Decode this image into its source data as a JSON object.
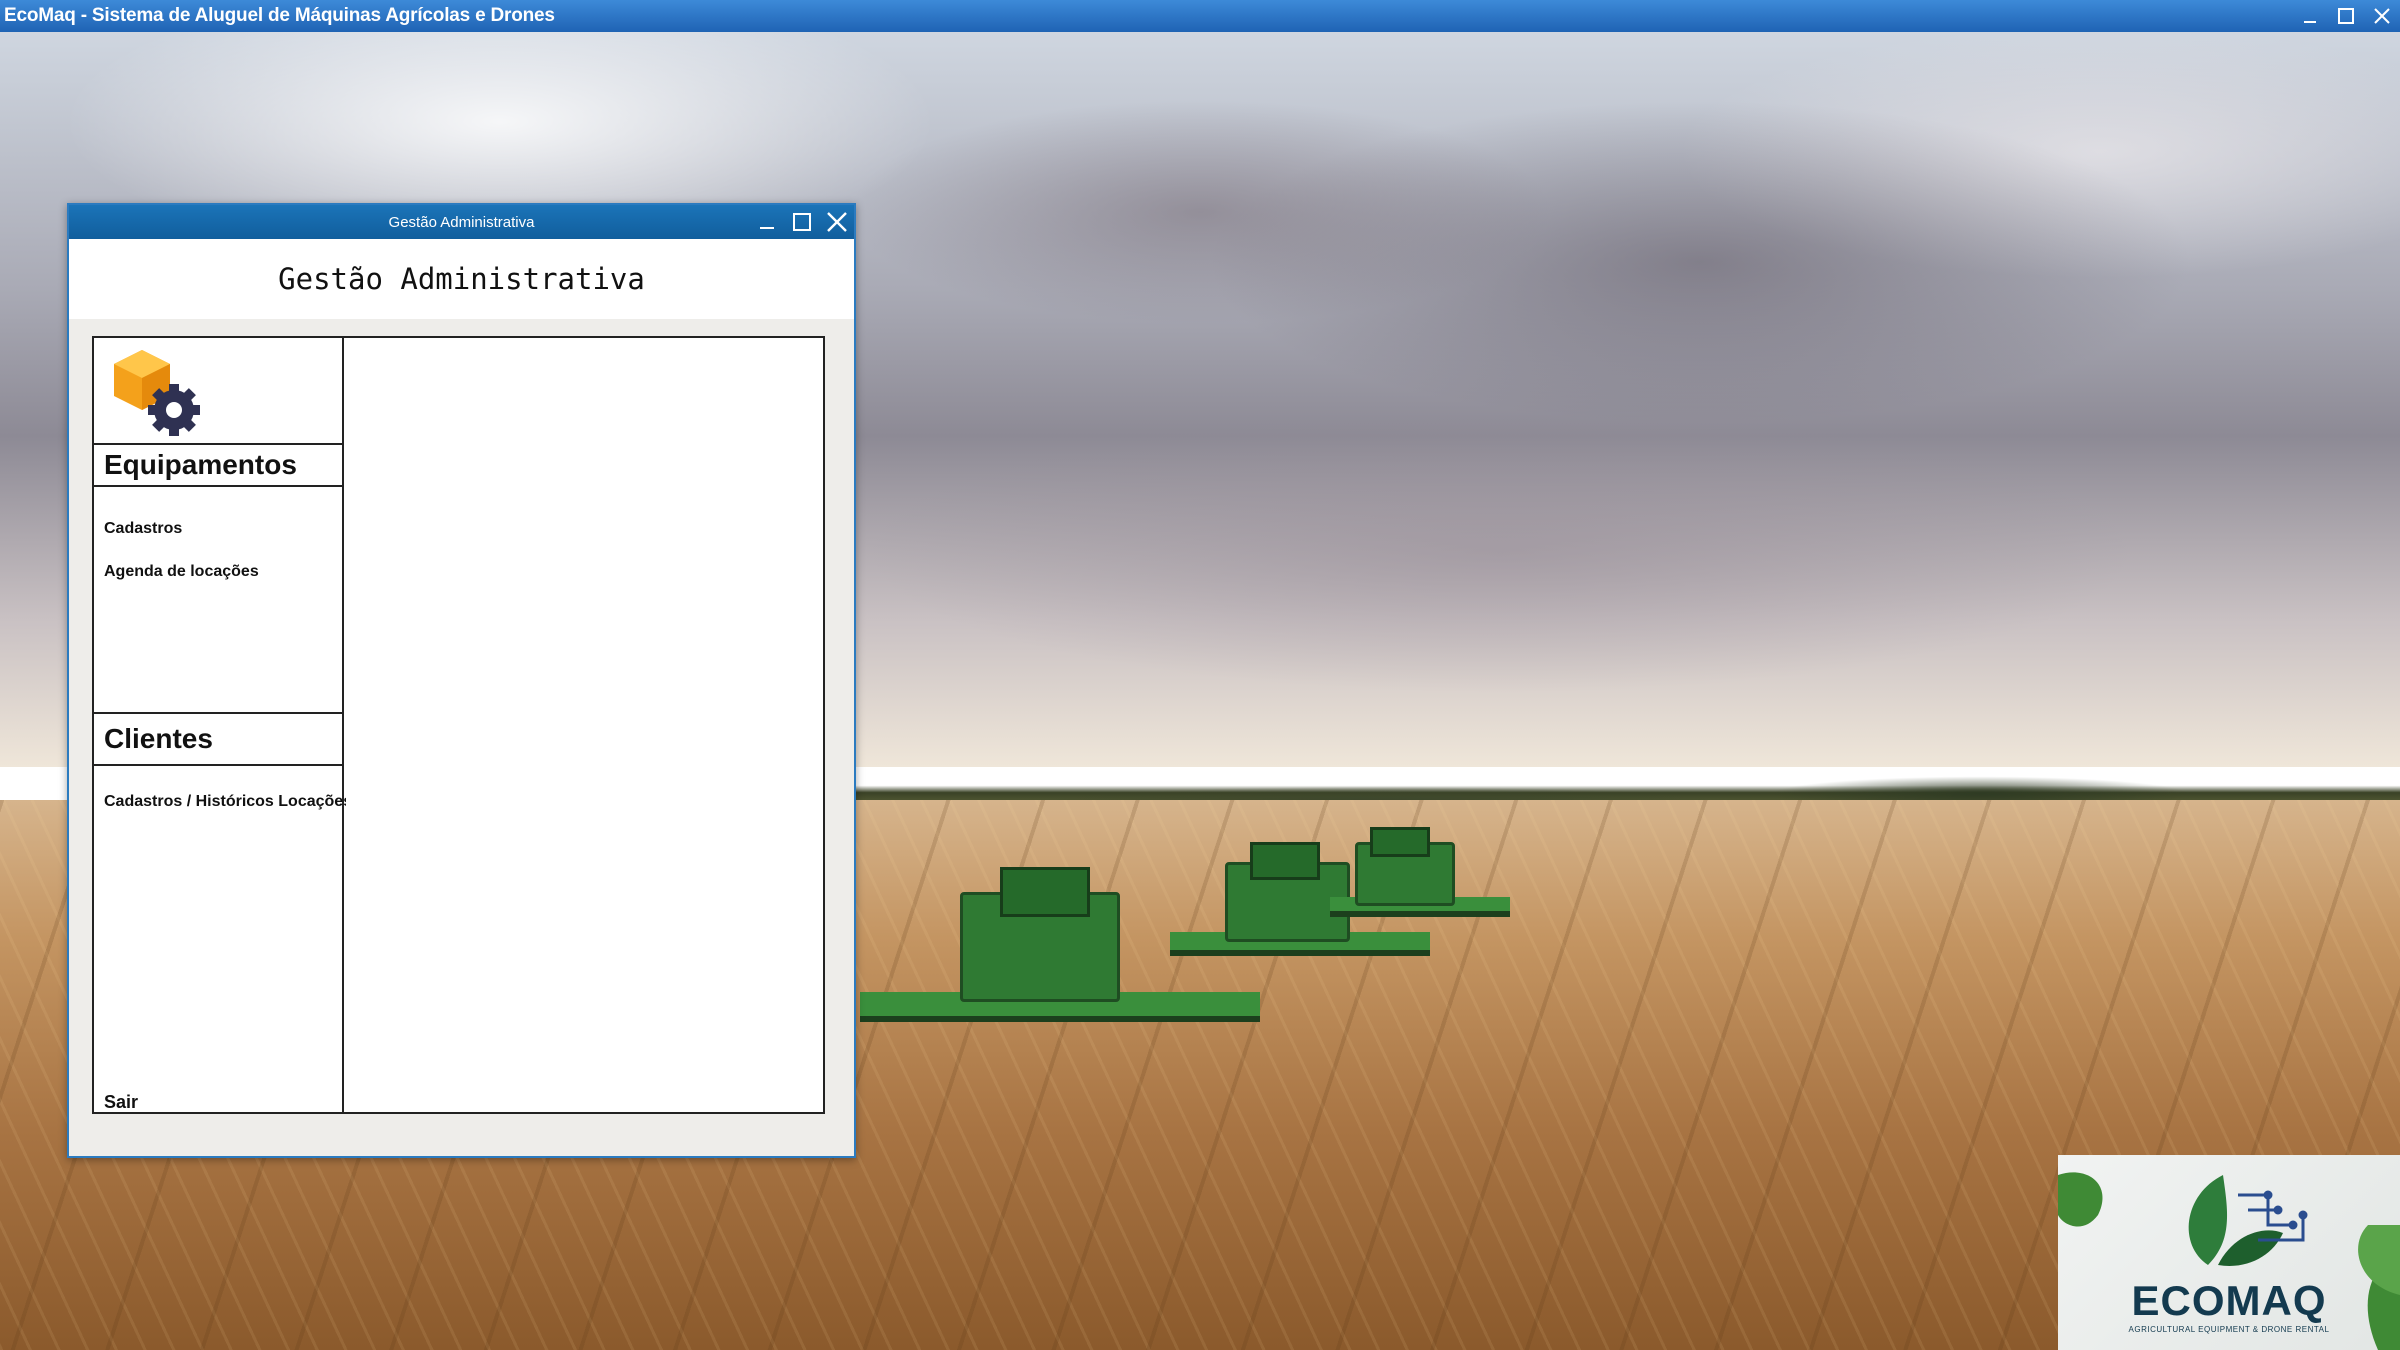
{
  "app": {
    "title": "EcoMaq - Sistema de Aluguel de Máquinas Agrícolas e Drones"
  },
  "window": {
    "title": "Gestão Administrativa",
    "heading": "Gestão Administrativa"
  },
  "menu": {
    "equipamentos": {
      "heading": "Equipamentos",
      "items": [
        "Cadastros",
        "Agenda de locações"
      ]
    },
    "clientes": {
      "heading": "Clientes",
      "items": [
        "Cadastros / Históricos Locações"
      ]
    },
    "exit_label": "Sair"
  },
  "brand": {
    "name": "ECOMAQ",
    "tagline": "AGRICULTURAL EQUIPMENT & DRONE RENTAL"
  },
  "icons": {
    "window_controls": [
      "minimize-icon",
      "maximize-icon",
      "close-icon"
    ],
    "module_icon": "cube-gear-icon"
  },
  "colors": {
    "titlebar": "#1f63b4",
    "inner_titlebar": "#1b74b8",
    "brand_text": "#133a4f",
    "icon_orange": "#f4a11b",
    "icon_gear": "#2f3152"
  }
}
